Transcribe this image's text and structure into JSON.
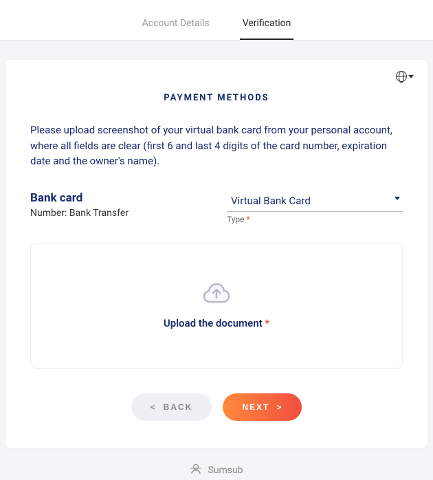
{
  "tabs": {
    "account": "Account Details",
    "verification": "Verification"
  },
  "section": {
    "title": "PAYMENT METHODS",
    "instructions": "Please upload screenshot of your virtual bank card from your personal account, where all fields are clear (first 6 and last 4 digits of the card number, expiration date and the owner's name)."
  },
  "bank": {
    "title": "Bank card",
    "number_label": "Number: Bank Transfer"
  },
  "type_select": {
    "value": "Virtual Bank Card",
    "label": "Type",
    "required": "*"
  },
  "upload": {
    "text": "Upload the document",
    "required": "*"
  },
  "nav": {
    "back": "BACK",
    "back_arrow": "<",
    "next": "NEXT",
    "next_arrow": ">"
  },
  "footer": {
    "brand": "Sumsub"
  }
}
